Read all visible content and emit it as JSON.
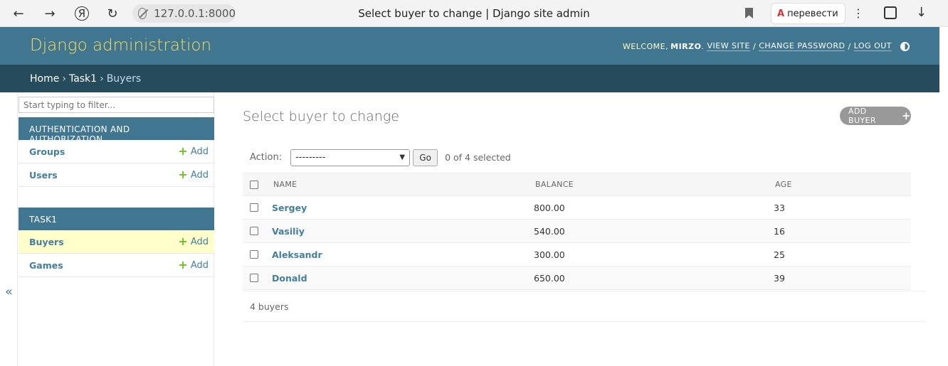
{
  "browser": {
    "address": "127.0.0.1:8000",
    "tab_title": "Select buyer to change | Django site admin",
    "translate_label": "перевести",
    "icons": [
      "back-icon",
      "forward-icon",
      "yandex-icon",
      "reload-icon",
      "site-info-icon",
      "bookmark-icon",
      "translate-icon",
      "kebab-menu-icon",
      "extensions-icon",
      "download-icon"
    ]
  },
  "header": {
    "site_name": "Django administration",
    "welcome": "WELCOME,",
    "username": "MIRZO",
    "view_site": "VIEW SITE",
    "change_password": "CHANGE PASSWORD",
    "log_out": "LOG OUT",
    "sep": "/"
  },
  "breadcrumbs": {
    "home": "Home",
    "app": "Task1",
    "current": "Buyers",
    "sep": "›"
  },
  "sidebar": {
    "filter_placeholder": "Start typing to filter...",
    "collapse": "«",
    "apps": [
      {
        "caption": "AUTHENTICATION AND AUTHORIZATION",
        "models": [
          {
            "label": "Groups",
            "add": "Add"
          },
          {
            "label": "Users",
            "add": "Add"
          }
        ]
      },
      {
        "caption": "TASK1",
        "models": [
          {
            "label": "Buyers",
            "add": "Add",
            "active": true
          },
          {
            "label": "Games",
            "add": "Add"
          }
        ]
      }
    ]
  },
  "main": {
    "title": "Select buyer to change",
    "add_button": "ADD BUYER",
    "action_label": "Action:",
    "action_selected": "---------",
    "go_label": "Go",
    "selection_counter": "0 of 4 selected",
    "columns": [
      "NAME",
      "BALANCE",
      "AGE"
    ],
    "rows": [
      {
        "name": "Sergey",
        "balance": "800.00",
        "age": "33"
      },
      {
        "name": "Vasiliy",
        "balance": "540.00",
        "age": "16"
      },
      {
        "name": "Aleksandr",
        "balance": "300.00",
        "age": "25"
      },
      {
        "name": "Donald",
        "balance": "650.00",
        "age": "39"
      }
    ],
    "result_count": "4 buyers"
  },
  "colors": {
    "header_bg": "#417690",
    "breadcrumb_bg": "#264b5d",
    "brand_yellow": "#f5dd5d",
    "link": "#447e9b",
    "add_green": "#70bf2b",
    "active_row": "#ffffcc"
  }
}
